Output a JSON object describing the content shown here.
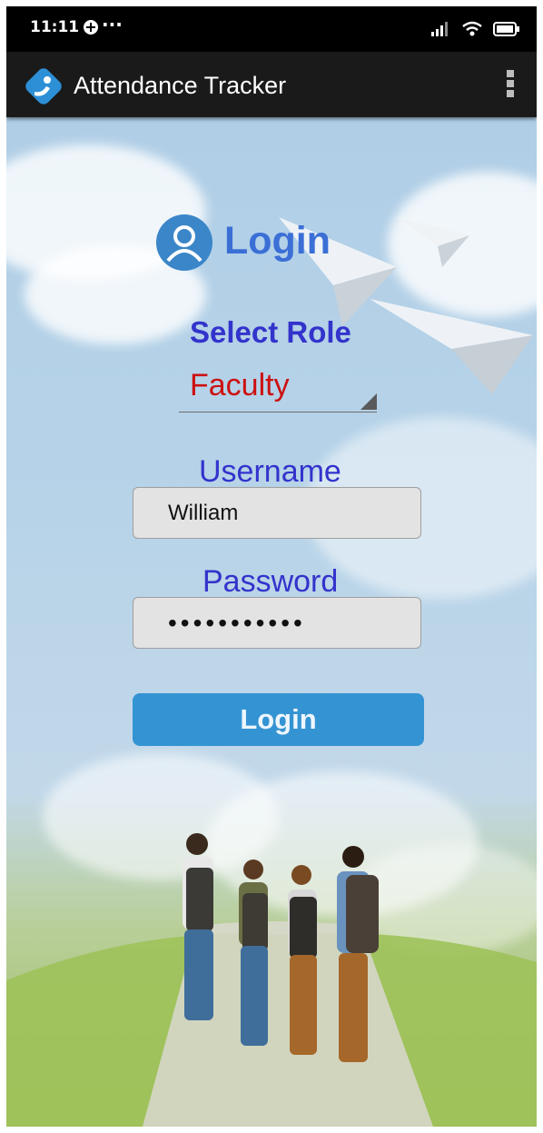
{
  "status_bar": {
    "time": "11:11",
    "more": "···",
    "icons": [
      "dnd-icon",
      "signal-icon",
      "wifi-icon",
      "battery-icon"
    ]
  },
  "app_bar": {
    "title": "Attendance Tracker",
    "icons": [
      "app-logo-icon",
      "overflow-menu-icon"
    ]
  },
  "login": {
    "title": "Login",
    "icon": "user-icon",
    "role_label": "Select Role",
    "role_value": "Faculty",
    "username_label": "Username",
    "username_value": "William",
    "password_label": "Password",
    "password_value": "•••••••••••",
    "button_label": "Login"
  },
  "colors": {
    "title": "#3b6fd6",
    "labels": "#3333cc",
    "role_value": "#cc1111",
    "button": "#3494d3",
    "app_bar": "#1a1a1a"
  }
}
